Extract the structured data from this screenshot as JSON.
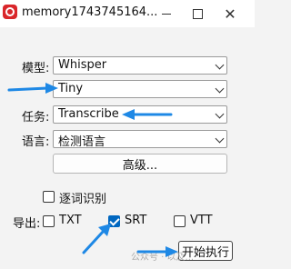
{
  "window": {
    "title": "memory1743745164...",
    "close_glyph": "✕"
  },
  "form": {
    "model": {
      "label": "模型:",
      "value": "Whisper"
    },
    "size": {
      "value": "Tiny"
    },
    "task": {
      "label": "任务:",
      "value": "Transcribe"
    },
    "language": {
      "label": "语言:",
      "value": "检测语言"
    },
    "advanced_button": "高级..."
  },
  "options": {
    "word_recognition": {
      "label": "逐词识别",
      "checked": false
    }
  },
  "export": {
    "label": "导出:",
    "formats": [
      {
        "label": "TXT",
        "checked": false
      },
      {
        "label": "SRT",
        "checked": true
      },
      {
        "label": "VTT",
        "checked": false
      }
    ]
  },
  "start_button": "开始执行",
  "watermark": "公众号 · 以及..."
}
